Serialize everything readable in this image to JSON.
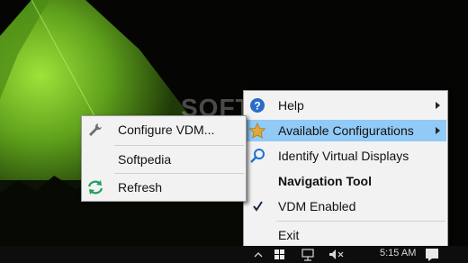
{
  "watermark": "SOFTPEDIA",
  "main_menu": {
    "items": [
      {
        "label": "Help",
        "icon": "help-icon",
        "submenu": true
      },
      {
        "label": "Available Configurations",
        "icon": "star-icon",
        "submenu": true,
        "highlighted": true
      },
      {
        "label": "Identify Virtual Displays",
        "icon": "magnifier-icon"
      },
      {
        "label": "Navigation Tool",
        "bold": true
      },
      {
        "label": "VDM Enabled",
        "icon": "checkmark-icon",
        "checked": true
      },
      {
        "label": "Exit"
      }
    ]
  },
  "sub_menu": {
    "items": [
      {
        "label": "Configure VDM...",
        "icon": "wrench-icon"
      },
      {
        "label": "Softpedia"
      },
      {
        "label": "Refresh",
        "icon": "refresh-icon"
      }
    ]
  },
  "taskbar": {
    "clock": "5:15 AM"
  },
  "colors": {
    "highlight": "#91c9f7",
    "menu_bg": "#f2f2f2",
    "wallpaper_green": "#7fcf2a"
  }
}
